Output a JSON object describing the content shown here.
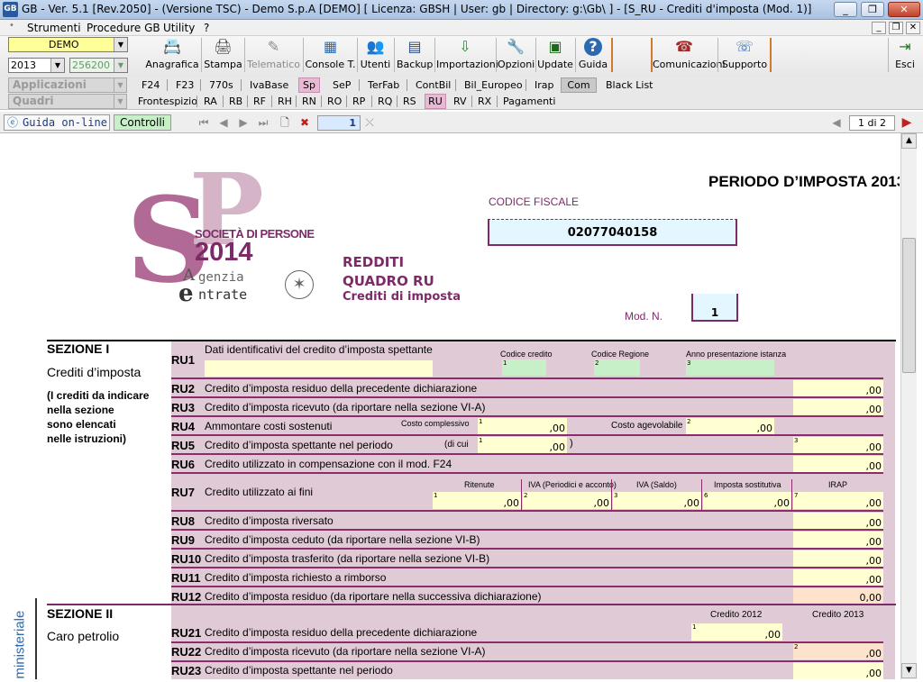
{
  "window": {
    "title": "GB - Ver. 5.1 [Rev.2050] - (Versione TSC) - Demo S.p.A [DEMO]     [ Licenza: GBSH | User: gb | Directory: g:\\Gb\\ ] - [S_RU - Crediti d'imposta (Mod. 1)]",
    "app_icon": "GB",
    "minimize": "_",
    "restore": "❐",
    "close": "✕"
  },
  "menu": {
    "items": [
      "Strumenti",
      "Procedure GB",
      "Utility",
      "?"
    ],
    "mdi_minimize": "_",
    "mdi_restore": "❐",
    "mdi_close": "✕"
  },
  "toolbar": {
    "company": "DEMO",
    "year": "2013",
    "code": "256200 -",
    "buttons": [
      {
        "label": "Anagrafica",
        "icon": "📇"
      },
      {
        "label": "Stampa",
        "icon": "🖨"
      },
      {
        "label": "Telematico",
        "icon": "✎"
      },
      {
        "label": "Console T.",
        "icon": "▦"
      },
      {
        "label": "Utenti",
        "icon": "👥"
      },
      {
        "label": "Backup",
        "icon": "▤"
      },
      {
        "label": "Importazioni",
        "icon": "⇩"
      },
      {
        "label": "Opzioni",
        "icon": "🔧"
      },
      {
        "label": "Update",
        "icon": "▣"
      },
      {
        "label": "Guida",
        "icon": "?"
      },
      {
        "label": "Comunicazioni",
        "icon": "☎"
      },
      {
        "label": "Supporto",
        "icon": "☏"
      },
      {
        "label": "Esci",
        "icon": "⇥"
      }
    ]
  },
  "apps": {
    "label": "Applicazioni",
    "tabs": [
      "F24",
      "F23",
      "770s",
      "IvaBase",
      "Sp",
      "SeP",
      "TerFab",
      "ContBil",
      "Bil_Europeo",
      "Irap",
      "Com",
      "Black List"
    ]
  },
  "quadri": {
    "label": "Quadri",
    "tabs": [
      "Frontespizio",
      "RA",
      "RB",
      "RF",
      "RH",
      "RN",
      "RO",
      "RP",
      "RQ",
      "RS",
      "RU",
      "RV",
      "RX",
      "Pagamenti"
    ]
  },
  "nav": {
    "guide_online": "Guida on-line",
    "controlli": "Controlli",
    "module_number": "1",
    "page_indicator": "1 di 2",
    "icons": [
      "first-icon",
      "prev-icon",
      "next-icon",
      "last-icon",
      "new-page-icon",
      "delete-page-icon"
    ]
  },
  "form": {
    "period": "PERIODO D’IMPOSTA 2013",
    "codice_fiscale_label": "CODICE FISCALE",
    "codice_fiscale": "02077040158",
    "logo_line1": "SOCIETÀ DI PERSONE",
    "logo_year": "2014",
    "logo_agency1": "genzia",
    "logo_agency2": "ntrate",
    "logo_big1": "S",
    "logo_big2": "P",
    "logo_a": "A",
    "logo_e": "e",
    "redditi": "REDDITI",
    "quadro": "QUADRO RU",
    "quadro_sub": "Crediti di imposta",
    "mod_label": "Mod. N.",
    "mod_value": "1",
    "side_vertical": "ministeriale",
    "sezione1": {
      "title": "SEZIONE I",
      "subtitle": "Crediti d’imposta",
      "note": [
        "(I crediti da indicare",
        "nella sezione",
        "sono elencati",
        "nelle istruzioni)"
      ]
    },
    "sezione2": {
      "title": "SEZIONE II",
      "subtitle": "Caro petrolio"
    },
    "ru1": {
      "code": "RU1",
      "desc": "Dati identificativi del credito d’imposta spettante",
      "codice_credito": "Codice credito",
      "codice_regione": "Codice Regione",
      "anno": "Anno presentazione istanza"
    },
    "rows": [
      {
        "code": "RU2",
        "desc": "Credito d’imposta residuo della precedente dichiarazione",
        "value": ",00"
      },
      {
        "code": "RU3",
        "desc": "Credito d’imposta ricevuto (da riportare nella sezione VI-A)",
        "value": ",00"
      },
      {
        "code": "RU4",
        "desc": "Ammontare costi sostenuti",
        "value": ""
      },
      {
        "code": "RU5",
        "desc": "Credito d’imposta spettante nel periodo",
        "value": ",00"
      },
      {
        "code": "RU6",
        "desc": "Credito utilizzato in compensazione con il mod. F24",
        "value": ",00"
      },
      {
        "code": "RU7",
        "desc": "Credito utilizzato ai fini",
        "value": ",00"
      },
      {
        "code": "RU8",
        "desc": "Credito d’imposta riversato",
        "value": ",00"
      },
      {
        "code": "RU9",
        "desc": "Credito d’imposta ceduto (da riportare nella sezione VI-B)",
        "value": ",00"
      },
      {
        "code": "RU10",
        "desc": "Credito d’imposta trasferito (da riportare nella sezione VI-B)",
        "value": ",00"
      },
      {
        "code": "RU11",
        "desc": "Credito d’imposta richiesto a rimborso",
        "value": ",00"
      },
      {
        "code": "RU12",
        "desc": "Credito d’imposta residuo (da riportare nella successiva dichiarazione)",
        "value": "0,00"
      }
    ],
    "ru4": {
      "costo_complessivo": "Costo complessivo",
      "costo_agevolabile": "Costo agevolabile",
      "v1": ",00",
      "v2": ",00"
    },
    "ru5": {
      "di_cui": "(di cui",
      "v1": ",00",
      "close": ")"
    },
    "ru7": {
      "ritenute": "Ritenute",
      "iva": "IVA (Periodici e acconto)",
      "iva_saldo": "IVA (Saldo)",
      "imposta": "Imposta sostitutiva",
      "irap": "IRAP",
      "v": ",00"
    },
    "sec2_headers": {
      "c2012": "Credito 2012",
      "c2013": "Credito 2013"
    },
    "sec2_rows": [
      {
        "code": "RU21",
        "desc": "Credito d’imposta residuo della precedente dichiarazione",
        "value": ",00"
      },
      {
        "code": "RU22",
        "desc": "Credito d’imposta ricevuto (da riportare nella sezione VI-A)",
        "value": ",00"
      },
      {
        "code": "RU23",
        "desc": "Credito d’imposta spettante nel periodo",
        "value": ",00"
      }
    ]
  },
  "colors": {
    "section_bg": "#e0cad6",
    "row_line": "#8b2c6c",
    "field_yellow": "#ffffd2",
    "field_green": "#c8f0c8",
    "title_purple": "#7d2a68"
  }
}
